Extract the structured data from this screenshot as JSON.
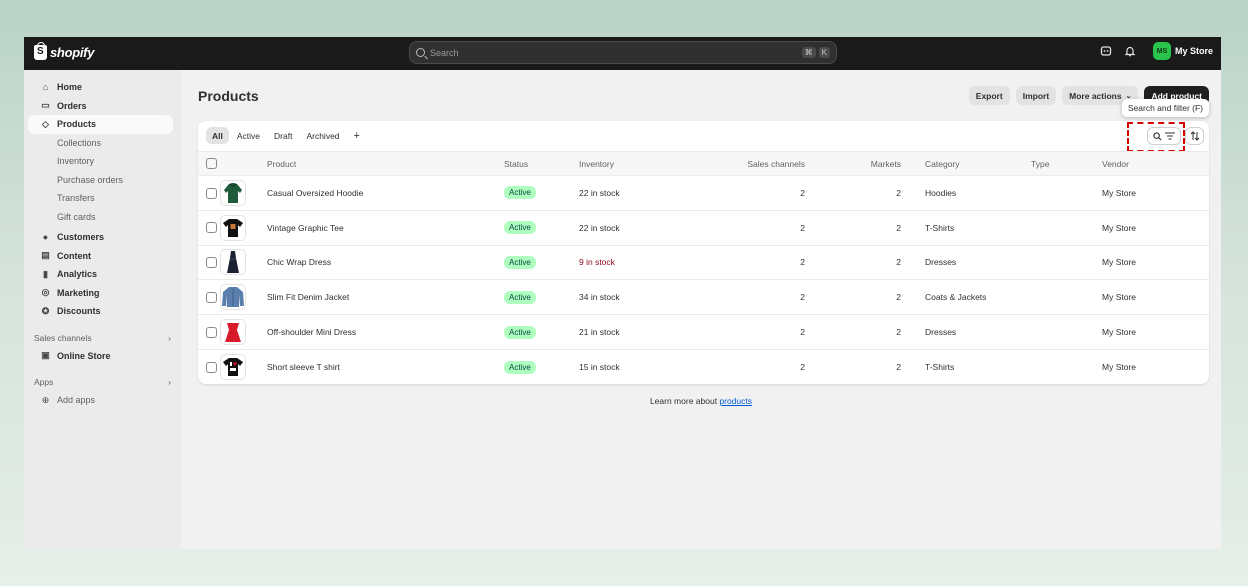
{
  "app": {
    "logo_text": "shopify"
  },
  "search": {
    "placeholder": "Search",
    "shortcut_keys": [
      "⌘",
      "K"
    ]
  },
  "topbar": {
    "store_initials": "MS",
    "store_name": "My Store",
    "avatar_color": "#2ac34c"
  },
  "sidebar": {
    "items": [
      {
        "label": "Home",
        "icon": "home-icon"
      },
      {
        "label": "Orders",
        "icon": "inbox-icon"
      },
      {
        "label": "Products",
        "icon": "tag-icon",
        "active": true
      },
      {
        "label": "Collections"
      },
      {
        "label": "Inventory"
      },
      {
        "label": "Purchase orders"
      },
      {
        "label": "Transfers"
      },
      {
        "label": "Gift cards"
      },
      {
        "label": "Customers",
        "icon": "person-icon"
      },
      {
        "label": "Content",
        "icon": "content-icon"
      },
      {
        "label": "Analytics",
        "icon": "analytics-icon"
      },
      {
        "label": "Marketing",
        "icon": "target-icon"
      },
      {
        "label": "Discounts",
        "icon": "discount-icon"
      }
    ],
    "sales_channels_label": "Sales channels",
    "online_store_label": "Online Store",
    "apps_label": "Apps",
    "add_apps_label": "Add apps"
  },
  "page": {
    "title": "Products",
    "export_label": "Export",
    "import_label": "Import",
    "more_actions_label": "More actions",
    "add_product_label": "Add product",
    "tooltip": "Search and filter (F)"
  },
  "tabs": [
    "All",
    "Active",
    "Draft",
    "Archived"
  ],
  "table": {
    "headers": {
      "product": "Product",
      "status": "Status",
      "inventory": "Inventory",
      "sales_channels": "Sales channels",
      "markets": "Markets",
      "category": "Category",
      "type": "Type",
      "vendor": "Vendor"
    },
    "rows": [
      {
        "name": "Casual Oversized Hoodie",
        "status": "Active",
        "inventory": "22 in stock",
        "sales_channels": "2",
        "markets": "2",
        "category": "Hoodies",
        "type": "",
        "vendor": "My Store"
      },
      {
        "name": "Vintage Graphic Tee",
        "status": "Active",
        "inventory": "22 in stock",
        "sales_channels": "2",
        "markets": "2",
        "category": "T-Shirts",
        "type": "",
        "vendor": "My Store"
      },
      {
        "name": "Chic Wrap Dress",
        "status": "Active",
        "inventory": "9 in stock",
        "sales_channels": "2",
        "markets": "2",
        "category": "Dresses",
        "type": "",
        "vendor": "My Store"
      },
      {
        "name": "Slim Fit Denim Jacket",
        "status": "Active",
        "inventory": "34 in stock",
        "sales_channels": "2",
        "markets": "2",
        "category": "Coats & Jackets",
        "type": "",
        "vendor": "My Store"
      },
      {
        "name": "Off-shoulder Mini Dress",
        "status": "Active",
        "inventory": "21 in stock",
        "sales_channels": "2",
        "markets": "2",
        "category": "Dresses",
        "type": "",
        "vendor": "My Store"
      },
      {
        "name": "Short sleeve T shirt",
        "status": "Active",
        "inventory": "15 in stock",
        "sales_channels": "2",
        "markets": "2",
        "category": "T-Shirts",
        "type": "",
        "vendor": "My Store"
      }
    ]
  },
  "footer": {
    "learn_prefix": "Learn more about ",
    "learn_link": "products"
  },
  "colors": {
    "badge_bg": "#affebf",
    "low_stock": "#8e0b21",
    "accent": "#005bd3"
  }
}
